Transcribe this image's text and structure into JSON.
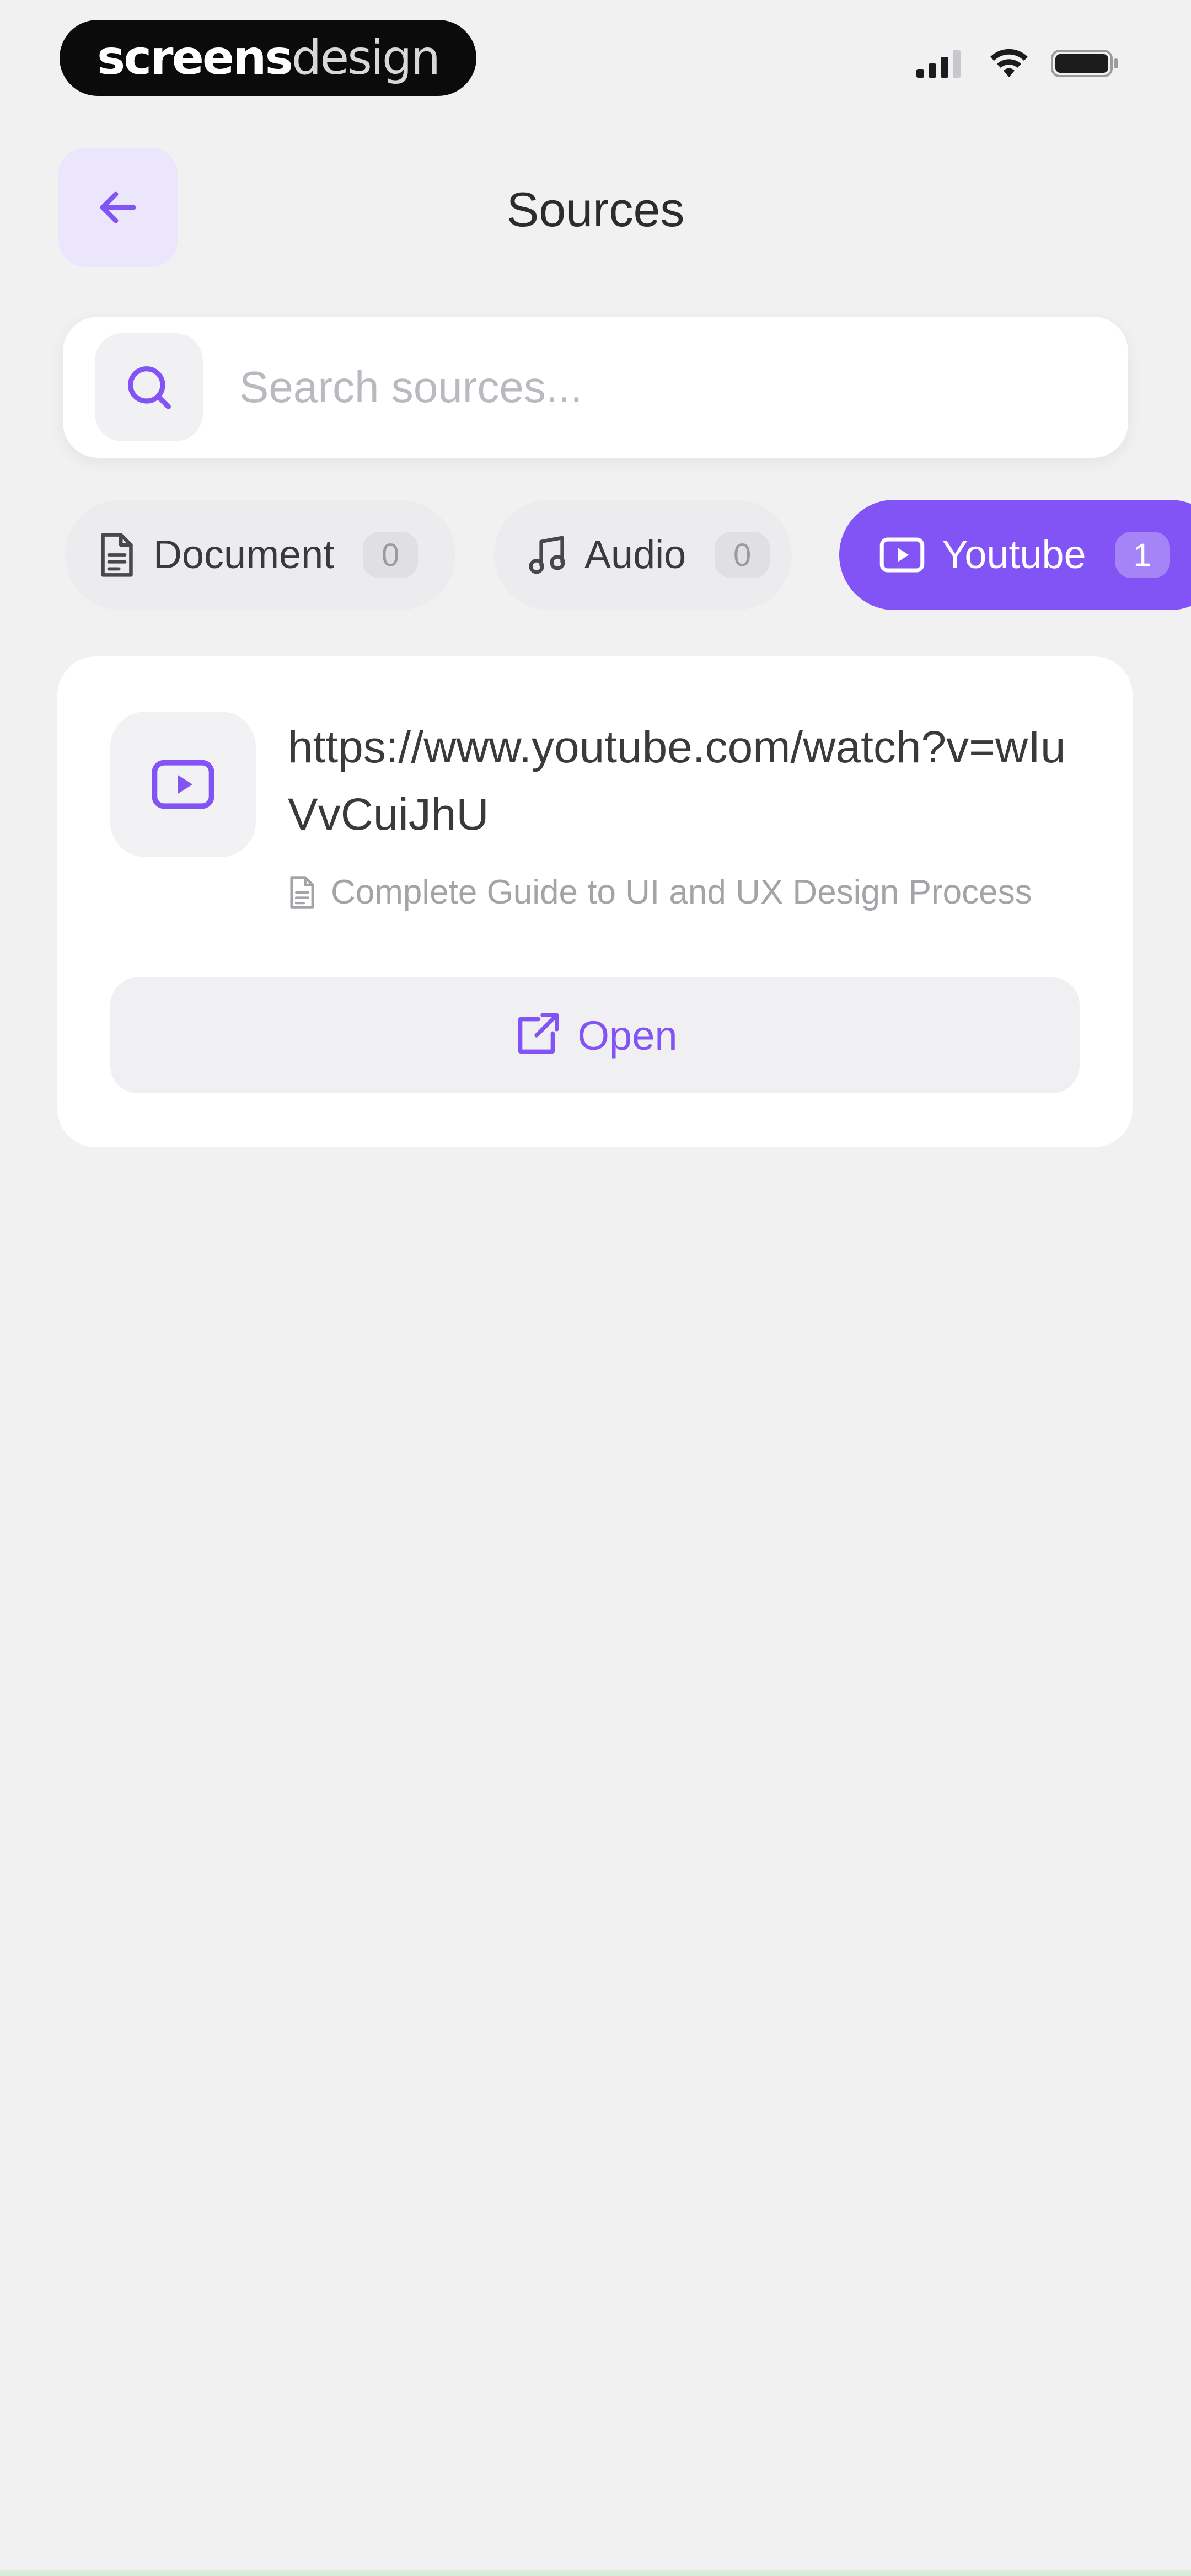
{
  "status_bar": {
    "brand_bold": "screens",
    "brand_light": "design"
  },
  "header": {
    "title": "Sources"
  },
  "search": {
    "placeholder": "Search sources..."
  },
  "tabs": [
    {
      "label": "Document",
      "count": "0",
      "icon": "document-icon",
      "active": false
    },
    {
      "label": "Audio",
      "count": "0",
      "icon": "music-note-icon",
      "active": false
    },
    {
      "label": "Youtube",
      "count": "1",
      "icon": "video-icon",
      "active": true
    }
  ],
  "sources": [
    {
      "url": "https://www.youtube.com/watch?v=wIuVvCuiJhU",
      "document_title": "Complete Guide to UI and UX Design Process",
      "open_label": "Open"
    }
  ],
  "colors": {
    "accent": "#8354f5",
    "background": "#f1f1f2",
    "card": "#ffffff"
  }
}
